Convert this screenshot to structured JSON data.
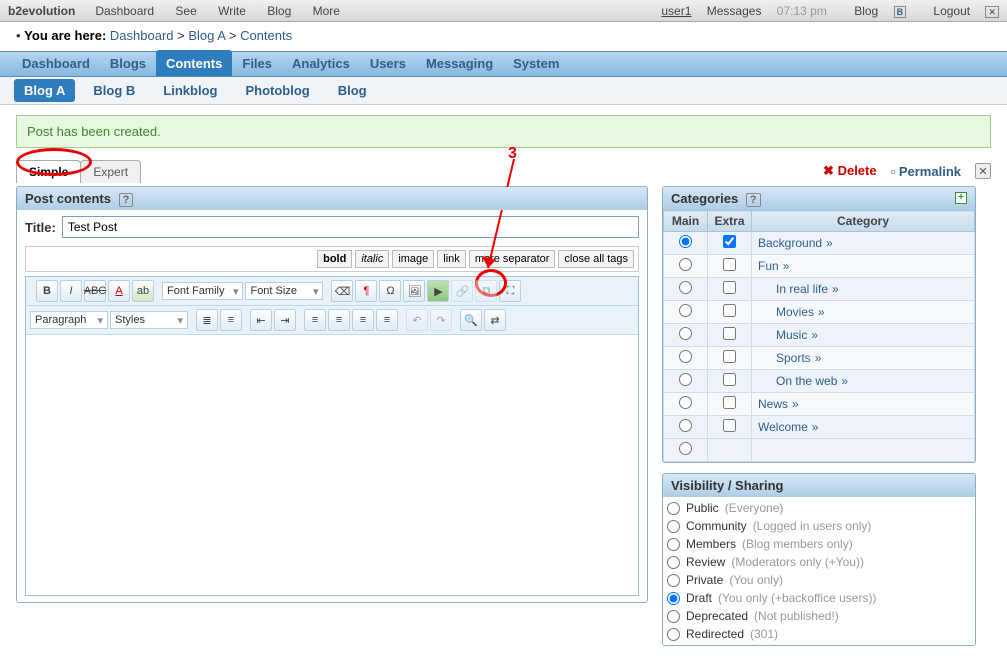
{
  "topbar": {
    "brand": "b2evolution",
    "left": [
      "Dashboard",
      "See",
      "Write",
      "Blog",
      "More"
    ],
    "user": "user1",
    "messages": "Messages",
    "time": "07:13 pm",
    "blog": "Blog",
    "logout": "Logout"
  },
  "breadcrumb": {
    "prefix": "You are here:",
    "parts": [
      "Dashboard",
      "Blog A",
      "Contents"
    ]
  },
  "maintabs": [
    "Dashboard",
    "Blogs",
    "Contents",
    "Files",
    "Analytics",
    "Users",
    "Messaging",
    "System"
  ],
  "maintabs_active": 2,
  "subtabs": [
    "Blog A",
    "Blog B",
    "Linkblog",
    "Photoblog",
    "Blog"
  ],
  "subtabs_active": 0,
  "message": "Post has been created.",
  "viewtabs": {
    "simple": "Simple",
    "expert": "Expert"
  },
  "actions": {
    "delete": "Delete",
    "permalink": "Permalink"
  },
  "annotation": {
    "label": "3"
  },
  "post": {
    "panel_title": "Post contents",
    "title_label": "Title:",
    "title_value": "Test Post",
    "quicktags": [
      "bold",
      "italic",
      "image",
      "link",
      "more separator",
      "close all tags"
    ],
    "format_select": "Paragraph",
    "styles_select": "Styles",
    "font_family": "Font Family",
    "font_size": "Font Size"
  },
  "categories": {
    "panel_title": "Categories",
    "cols": [
      "Main",
      "Extra",
      "Category"
    ],
    "rows": [
      {
        "main": true,
        "extra": true,
        "label": "Background",
        "indent": 0
      },
      {
        "main": false,
        "extra": false,
        "label": "Fun",
        "indent": 0
      },
      {
        "main": false,
        "extra": false,
        "label": "In real life",
        "indent": 1
      },
      {
        "main": false,
        "extra": false,
        "label": "Movies",
        "indent": 1
      },
      {
        "main": false,
        "extra": false,
        "label": "Music",
        "indent": 1
      },
      {
        "main": false,
        "extra": false,
        "label": "Sports",
        "indent": 1
      },
      {
        "main": false,
        "extra": false,
        "label": "On the web",
        "indent": 1
      },
      {
        "main": false,
        "extra": false,
        "label": "News",
        "indent": 0
      },
      {
        "main": false,
        "extra": false,
        "label": "Welcome",
        "indent": 0
      }
    ]
  },
  "visibility": {
    "panel_title": "Visibility / Sharing",
    "options": [
      {
        "label": "Public",
        "note": "(Everyone)",
        "sel": false
      },
      {
        "label": "Community",
        "note": "(Logged in users only)",
        "sel": false
      },
      {
        "label": "Members",
        "note": "(Blog members only)",
        "sel": false
      },
      {
        "label": "Review",
        "note": "(Moderators only (+You))",
        "sel": false
      },
      {
        "label": "Private",
        "note": "(You only)",
        "sel": false
      },
      {
        "label": "Draft",
        "note": "(You only (+backoffice users))",
        "sel": true
      },
      {
        "label": "Deprecated",
        "note": "(Not published!)",
        "sel": false
      },
      {
        "label": "Redirected",
        "note": "(301)",
        "sel": false
      }
    ]
  }
}
